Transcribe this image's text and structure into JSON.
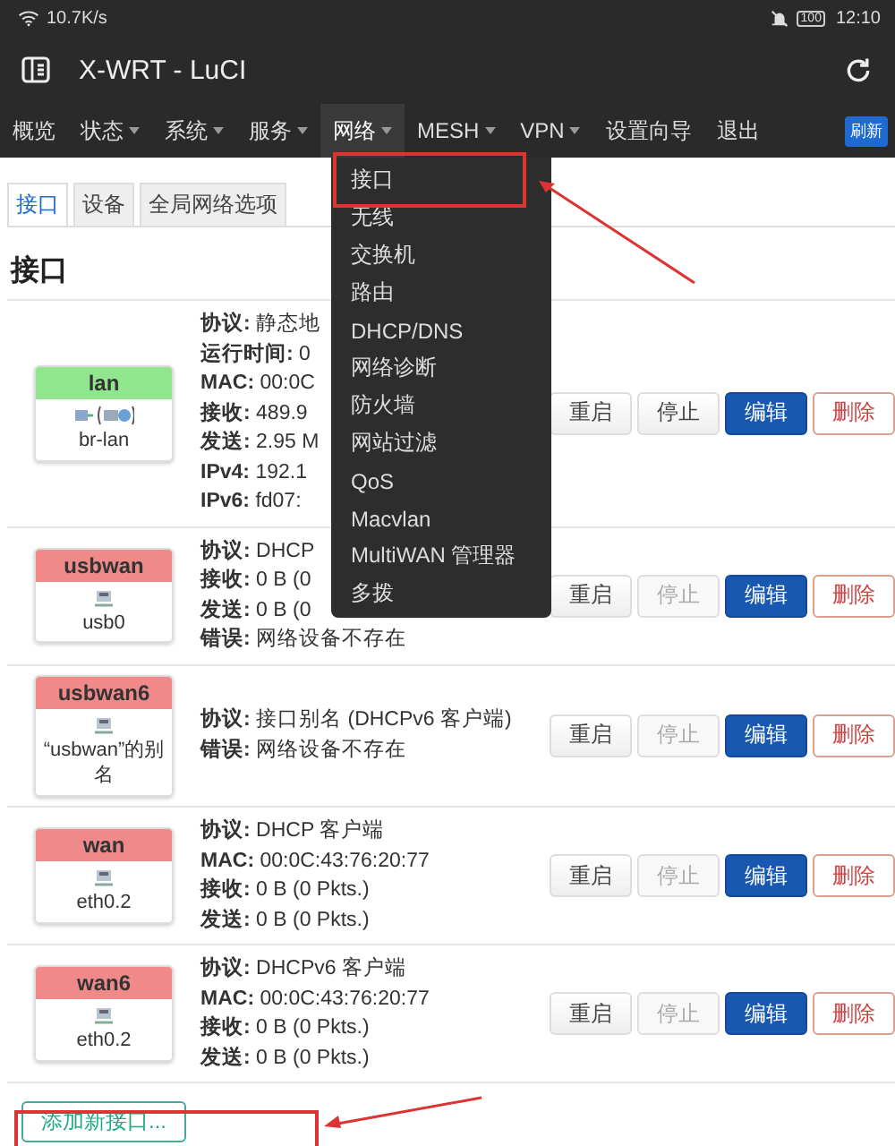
{
  "status_bar": {
    "speed": "10.7K/s",
    "battery": "100",
    "time": "12:10"
  },
  "window": {
    "title": "X-WRT - LuCI"
  },
  "nav": [
    {
      "label": "概览",
      "dropdown": false,
      "selected": false
    },
    {
      "label": "状态",
      "dropdown": true,
      "selected": false
    },
    {
      "label": "系统",
      "dropdown": true,
      "selected": false
    },
    {
      "label": "服务",
      "dropdown": true,
      "selected": false
    },
    {
      "label": "网络",
      "dropdown": true,
      "selected": true
    },
    {
      "label": "MESH",
      "dropdown": true,
      "selected": false
    },
    {
      "label": "VPN",
      "dropdown": true,
      "selected": false
    },
    {
      "label": "设置向导",
      "dropdown": false,
      "selected": false
    },
    {
      "label": "退出",
      "dropdown": false,
      "selected": false
    }
  ],
  "refresh_badge": "刷新",
  "menu": [
    "接口",
    "无线",
    "交换机",
    "路由",
    "DHCP/DNS",
    "网络诊断",
    "防火墙",
    "网站过滤",
    "QoS",
    "Macvlan",
    "MultiWAN 管理器",
    "多拨"
  ],
  "tabs": [
    {
      "label": "接口",
      "selected": true
    },
    {
      "label": "设备",
      "selected": false
    },
    {
      "label": "全局网络选项",
      "selected": false
    }
  ],
  "heading": "接口",
  "interfaces": [
    {
      "name": "lan",
      "color": "#90e68c",
      "device": "br-lan",
      "bridge": true,
      "info": [
        [
          "协议:",
          "静态地"
        ],
        [
          "运行时间:",
          "0"
        ],
        [
          "MAC:",
          "00:0C"
        ],
        [
          "接收:",
          "489.9"
        ],
        [
          "发送:",
          "2.95 M"
        ],
        [
          "IPv4:",
          "192.1"
        ],
        [
          "IPv6:",
          "fd07:"
        ]
      ],
      "stop_disabled": false,
      "buttons": [
        "重启",
        "停止",
        "编辑",
        "删除"
      ]
    },
    {
      "name": "usbwan",
      "color": "#f08a8a",
      "device": "usb0",
      "bridge": false,
      "info": [
        [
          "协议:",
          "DHCP"
        ],
        [
          "接收:",
          "0 B (0"
        ],
        [
          "发送:",
          "0 B (0"
        ],
        [
          "错误:",
          "网络设备不存在"
        ]
      ],
      "stop_disabled": true,
      "buttons": [
        "重启",
        "停止",
        "编辑",
        "删除"
      ]
    },
    {
      "name": "usbwan6",
      "color": "#f08a8a",
      "device": "“usbwan”的别名",
      "bridge": false,
      "info": [
        [
          "协议:",
          "接口别名 (DHCPv6 客户端)"
        ],
        [
          "错误:",
          "网络设备不存在"
        ]
      ],
      "stop_disabled": true,
      "buttons": [
        "重启",
        "停止",
        "编辑",
        "删除"
      ]
    },
    {
      "name": "wan",
      "color": "#f08a8a",
      "device": "eth0.2",
      "bridge": false,
      "info": [
        [
          "协议:",
          "DHCP 客户端"
        ],
        [
          "MAC:",
          "00:0C:43:76:20:77"
        ],
        [
          "接收:",
          "0 B (0 Pkts.)"
        ],
        [
          "发送:",
          "0 B (0 Pkts.)"
        ]
      ],
      "stop_disabled": true,
      "buttons": [
        "重启",
        "停止",
        "编辑",
        "删除"
      ]
    },
    {
      "name": "wan6",
      "color": "#f08a8a",
      "device": "eth0.2",
      "bridge": false,
      "info": [
        [
          "协议:",
          "DHCPv6 客户端"
        ],
        [
          "MAC:",
          "00:0C:43:76:20:77"
        ],
        [
          "接收:",
          "0 B (0 Pkts.)"
        ],
        [
          "发送:",
          "0 B (0 Pkts.)"
        ]
      ],
      "stop_disabled": true,
      "buttons": [
        "重启",
        "停止",
        "编辑",
        "删除"
      ]
    }
  ],
  "add_button": "添加新接口..."
}
